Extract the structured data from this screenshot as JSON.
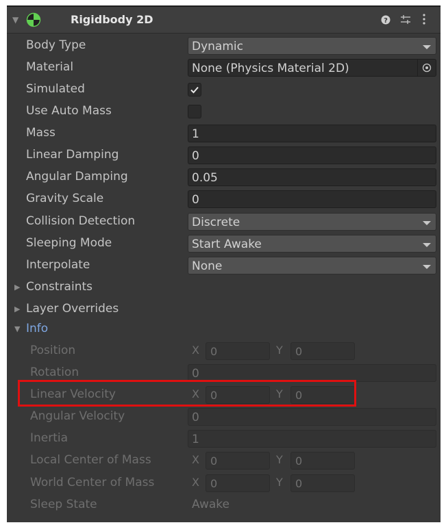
{
  "component": {
    "title": "Rigidbody 2D",
    "icon": "rigidbody-2d-icon",
    "header_icons": [
      "help-icon",
      "preset-icon",
      "kebab-menu-icon"
    ]
  },
  "properties": {
    "body_type": {
      "label": "Body Type",
      "value": "Dynamic"
    },
    "material": {
      "label": "Material",
      "value": "None (Physics Material 2D)"
    },
    "simulated": {
      "label": "Simulated",
      "checked": true
    },
    "use_auto_mass": {
      "label": "Use Auto Mass",
      "checked": false
    },
    "mass": {
      "label": "Mass",
      "value": "1"
    },
    "linear_damping": {
      "label": "Linear Damping",
      "value": "0"
    },
    "angular_damping": {
      "label": "Angular Damping",
      "value": "0.05"
    },
    "gravity_scale": {
      "label": "Gravity Scale",
      "value": "0"
    },
    "collision_detection": {
      "label": "Collision Detection",
      "value": "Discrete"
    },
    "sleeping_mode": {
      "label": "Sleeping Mode",
      "value": "Start Awake"
    },
    "interpolate": {
      "label": "Interpolate",
      "value": "None"
    }
  },
  "foldouts": {
    "constraints": {
      "label": "Constraints",
      "expanded": false
    },
    "layer_overrides": {
      "label": "Layer Overrides",
      "expanded": false
    },
    "info": {
      "label": "Info",
      "expanded": true
    }
  },
  "info": {
    "position": {
      "label": "Position",
      "x_label": "X",
      "x": "0",
      "y_label": "Y",
      "y": "0"
    },
    "rotation": {
      "label": "Rotation",
      "value": "0"
    },
    "linear_velocity": {
      "label": "Linear Velocity",
      "x_label": "X",
      "x": "0",
      "y_label": "Y",
      "y": "0"
    },
    "angular_velocity": {
      "label": "Angular Velocity",
      "value": "0"
    },
    "inertia": {
      "label": "Inertia",
      "value": "1"
    },
    "local_center_of_mass": {
      "label": "Local Center of Mass",
      "x_label": "X",
      "x": "0",
      "y_label": "Y",
      "y": "0"
    },
    "world_center_of_mass": {
      "label": "World Center of Mass",
      "x_label": "X",
      "x": "0",
      "y_label": "Y",
      "y": "0"
    },
    "sleep_state": {
      "label": "Sleep State",
      "value": "Awake"
    }
  },
  "colors": {
    "panel_bg": "#383838",
    "info_label": "#7ea6e0",
    "highlight_box": "#e01010"
  }
}
